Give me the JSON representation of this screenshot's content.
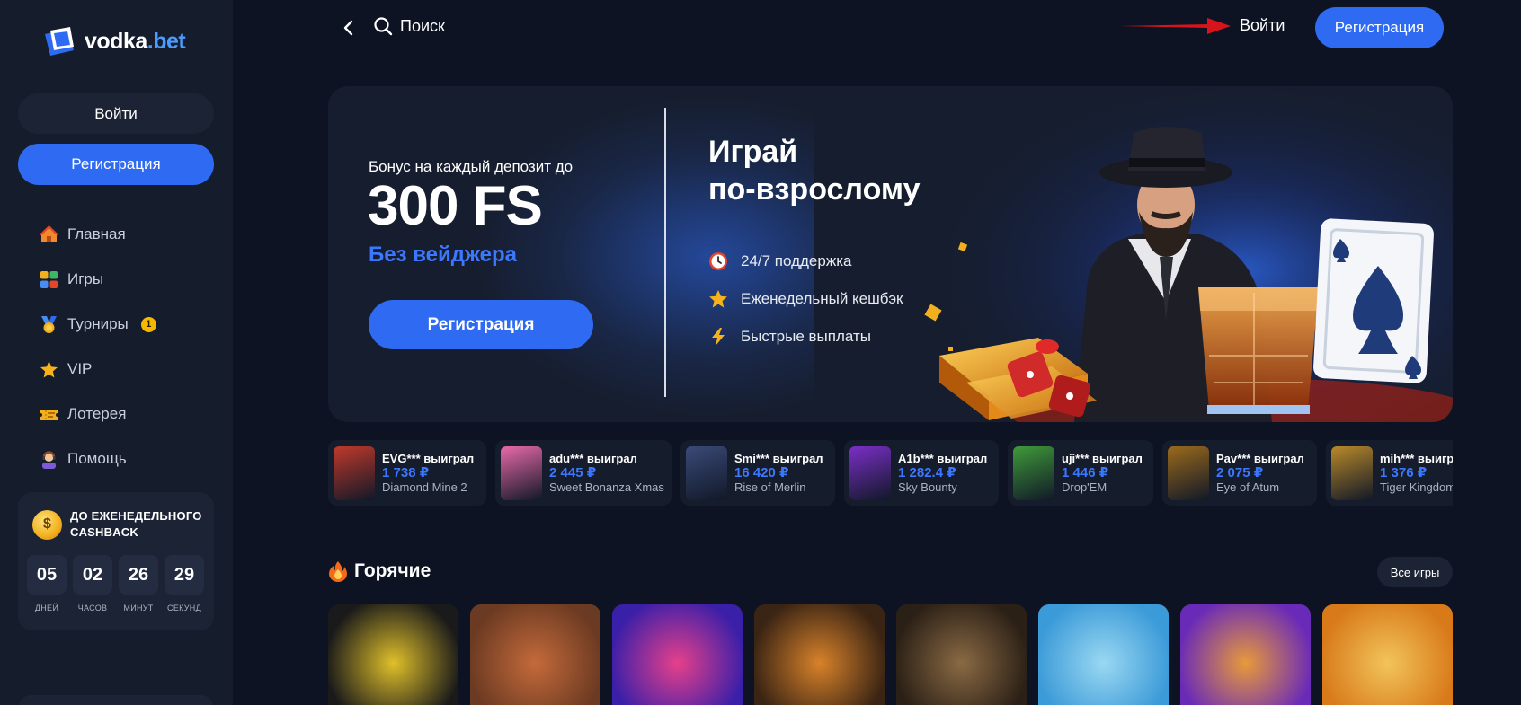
{
  "brand": {
    "name_part1": "vodka",
    "name_part2": ".bet"
  },
  "sidebar": {
    "login_label": "Войти",
    "register_label": "Регистрация",
    "nav": [
      {
        "label": "Главная",
        "icon": "home-icon"
      },
      {
        "label": "Игры",
        "icon": "games-grid-icon"
      },
      {
        "label": "Турниры",
        "icon": "medal-icon",
        "badge": "1"
      },
      {
        "label": "VIP",
        "icon": "star-icon"
      },
      {
        "label": "Лотерея",
        "icon": "ticket-icon"
      },
      {
        "label": "Помощь",
        "icon": "support-agent-icon"
      }
    ],
    "cashback": {
      "title": "ДО ЕЖЕНЕДЕЛЬНОГО CASHBACK",
      "timer": [
        {
          "value": "05",
          "label": "ДНЕЙ"
        },
        {
          "value": "02",
          "label": "ЧАСОВ"
        },
        {
          "value": "26",
          "label": "МИНУТ"
        },
        {
          "value": "29",
          "label": "СЕКУНД"
        }
      ]
    }
  },
  "topbar": {
    "search_label": "Поиск",
    "login_label": "Войти",
    "register_label": "Регистрация"
  },
  "banner": {
    "subtitle": "Бонус на каждый депозит до",
    "big": "300 FS",
    "highlight": "Без вейджера",
    "cta": "Регистрация",
    "heading_line1": "Играй",
    "heading_line2": "по-взрослому",
    "features": [
      {
        "label": "24/7 поддержка",
        "icon": "clock-icon"
      },
      {
        "label": "Еженедельный кешбэк",
        "icon": "star-icon"
      },
      {
        "label": "Быстрые выплаты",
        "icon": "lightning-icon"
      }
    ]
  },
  "winners": [
    {
      "user": "EVG*** выиграл",
      "amount": "1 738 ₽",
      "game": "Diamond Mine 2",
      "color": "#c0392b"
    },
    {
      "user": "adu*** выиграл",
      "amount": "2 445 ₽",
      "game": "Sweet Bonanza Xmas",
      "color": "#e76aa8"
    },
    {
      "user": "Smi*** выиграл",
      "amount": "16 420 ₽",
      "game": "Rise of Merlin",
      "color": "#3a4a78"
    },
    {
      "user": "A1b*** выиграл",
      "amount": "1 282.4 ₽",
      "game": "Sky Bounty",
      "color": "#7a2fc7"
    },
    {
      "user": "uji*** выиграл",
      "amount": "1 446 ₽",
      "game": "Drop'EM",
      "color": "#3f9a3a"
    },
    {
      "user": "Pav*** выиграл",
      "amount": "2 075 ₽",
      "game": "Eye of Atum",
      "color": "#9a6a1c"
    },
    {
      "user": "mih*** выиграл",
      "amount": "1 376 ₽",
      "game": "Tiger Kingdom",
      "color": "#b8892a"
    }
  ],
  "hot": {
    "title": "Горячие",
    "all_games_label": "Все игры",
    "games": [
      {
        "name": "lucky-streak-3",
        "color": "#1a1a1a",
        "color2": "#e0c02a"
      },
      {
        "name": "bull-game",
        "color": "#6b3a22",
        "color2": "#c46a3a"
      },
      {
        "name": "dj-fruit-game",
        "color": "#3a1fa8",
        "color2": "#e6408a"
      },
      {
        "name": "goblin-lantern-game",
        "color": "#3a2414",
        "color2": "#d8822a"
      },
      {
        "name": "boothill",
        "color": "#2b2016",
        "color2": "#8a6a44"
      },
      {
        "name": "fishing-game",
        "color": "#3b9ad8",
        "color2": "#9ad8f2"
      },
      {
        "name": "buffalo-game",
        "color": "#6a2ab8",
        "color2": "#e89a3a"
      },
      {
        "name": "king-game",
        "color": "#d87a1a",
        "color2": "#f2c45a"
      }
    ]
  },
  "colors": {
    "accent": "#2f6bf2",
    "highlight": "#3b78ff",
    "bg": "#0d1322",
    "panel": "#151c2c"
  }
}
